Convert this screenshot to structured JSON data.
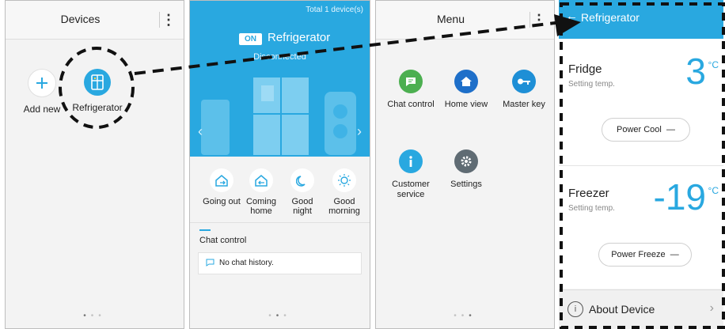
{
  "devices": {
    "title": "Devices",
    "items": [
      {
        "label": "Add new",
        "icon": "plus-icon"
      },
      {
        "label": "Refrigerator",
        "icon": "refrigerator-icon"
      }
    ]
  },
  "home": {
    "total": "Total 1 device(s)",
    "status": "ON",
    "device_name": "Refrigerator",
    "substatus": "Disconnected",
    "modes": [
      {
        "label": "Going out",
        "icon": "going-out-icon"
      },
      {
        "label": "Coming home",
        "icon": "coming-home-icon"
      },
      {
        "label": "Good night",
        "icon": "good-night-icon"
      },
      {
        "label": "Good morning",
        "icon": "good-morning-icon"
      }
    ],
    "chat_title": "Chat control",
    "chat_empty": "No chat history."
  },
  "menu": {
    "title": "Menu",
    "items": [
      {
        "label": "Chat control",
        "icon": "chat-icon",
        "color": "#4caf50"
      },
      {
        "label": "Home view",
        "icon": "home-icon",
        "color": "#1e6fc9"
      },
      {
        "label": "Master key",
        "icon": "key-icon",
        "color": "#1e8fd6"
      },
      {
        "label": "Customer service",
        "icon": "info-icon",
        "color": "#29a8e0"
      },
      {
        "label": "Settings",
        "icon": "gear-icon",
        "color": "#5f6b73"
      }
    ]
  },
  "fridge_detail": {
    "title": "Refrigerator",
    "fridge": {
      "name": "Fridge",
      "sub": "Setting temp.",
      "temp": "3",
      "unit": "°C",
      "button": "Power Cool"
    },
    "freezer": {
      "name": "Freezer",
      "sub": "Setting temp.",
      "temp": "-19",
      "unit": "°C",
      "button": "Power Freeze"
    },
    "about": "About Device"
  },
  "colors": {
    "accent": "#29a8e0"
  }
}
